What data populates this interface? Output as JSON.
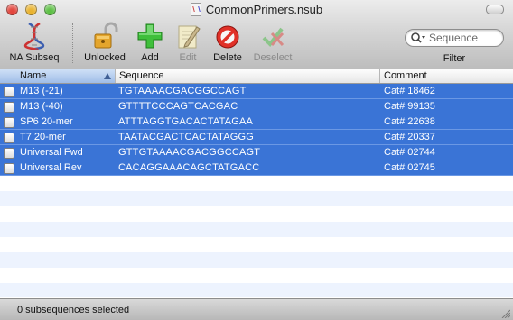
{
  "window": {
    "title": "CommonPrimers.nsub"
  },
  "toolbar": {
    "items": [
      {
        "label": "NA Subseq",
        "icon": "dna-helix-icon",
        "enabled": true
      },
      {
        "label": "Unlocked",
        "icon": "unlocked-padlock-icon",
        "enabled": true
      },
      {
        "label": "Add",
        "icon": "green-plus-icon",
        "enabled": true
      },
      {
        "label": "Edit",
        "icon": "pencil-notepad-icon",
        "enabled": false
      },
      {
        "label": "Delete",
        "icon": "red-no-symbol-icon",
        "enabled": true
      },
      {
        "label": "Deselect",
        "icon": "deselect-check-icon",
        "enabled": false
      }
    ],
    "search_placeholder": "Sequence",
    "filter_label": "Filter"
  },
  "table": {
    "columns": [
      "Name",
      "Sequence",
      "Comment"
    ],
    "sorted_column": "Name",
    "rows": [
      {
        "name": "M13 (-21)",
        "sequence": "TGTAAAACGACGGCCAGT",
        "comment": "Cat# 18462"
      },
      {
        "name": "M13 (-40)",
        "sequence": "GTTTTCCCAGTCACGAC",
        "comment": "Cat# 99135"
      },
      {
        "name": "SP6 20-mer",
        "sequence": "ATTTAGGTGACACTATAGAA",
        "comment": "Cat# 22638"
      },
      {
        "name": "T7 20-mer",
        "sequence": "TAATACGACTCACTATAGGG",
        "comment": "Cat# 20337"
      },
      {
        "name": "Universal Fwd",
        "sequence": "GTTGTAAAACGACGGCCAGT",
        "comment": "Cat# 02744"
      },
      {
        "name": "Universal Rev",
        "sequence": "CACAGGAAACAGCTATGACC",
        "comment": "Cat# 02745"
      }
    ]
  },
  "status": {
    "text": "0 subsequences selected"
  },
  "colors": {
    "selection": "#3a74d6",
    "stripe": "#edf3fe"
  }
}
